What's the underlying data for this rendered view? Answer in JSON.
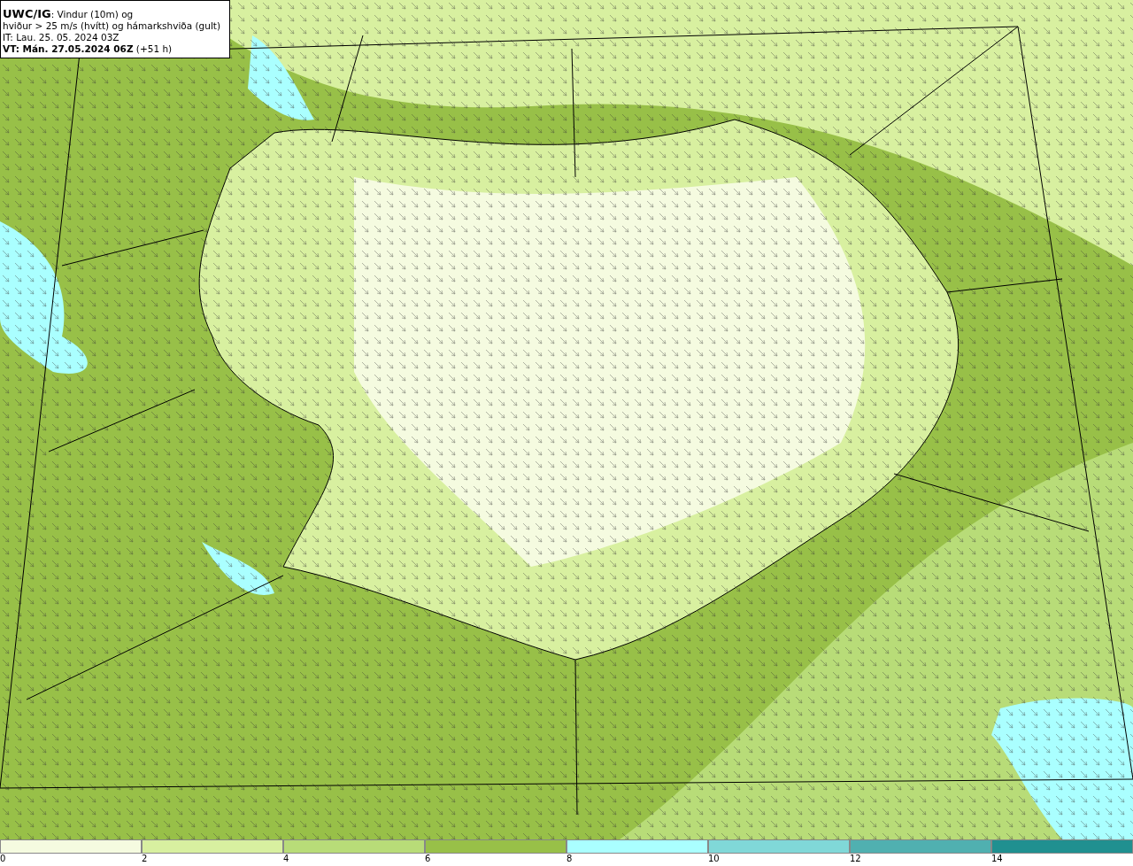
{
  "title_box": {
    "lines": [
      "**UWC/IG**: Vindur (10m) og",
      "hviður > 25 m/s (hvítt) og hámarkshviða (gult)",
      "IT: Lau. 25. 05. 2024 03Z",
      "**VT: Mán. 27.05.2024 06Z** (+51 h)"
    ]
  },
  "legend": [
    {
      "label": "0",
      "color": "#f5fbe0"
    },
    {
      "label": "2",
      "color": "#d8f0a0"
    },
    {
      "label": "4",
      "color": "#b8dc78"
    },
    {
      "label": "6",
      "color": "#98c048"
    },
    {
      "label": "8",
      "color": "#aaffff"
    },
    {
      "label": "10",
      "color": "#80d8d8"
    },
    {
      "label": "12",
      "color": "#50b0b0"
    },
    {
      "label": "14",
      "color": "#209090"
    }
  ]
}
